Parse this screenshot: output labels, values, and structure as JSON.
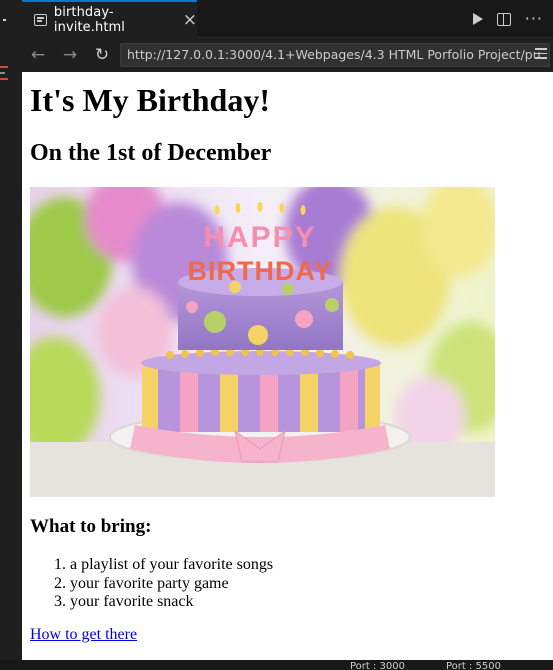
{
  "tab": {
    "title": "birthday-invite.html",
    "close": "×"
  },
  "nav": {
    "back": "←",
    "forward": "→",
    "reload": "↻",
    "url": "http://127.0.0.1:3000/4.1+Webpages/4.3 HTML Porfolio Project/pu"
  },
  "page": {
    "heading": "It's My Birthday!",
    "subheading": "On the 1st of December",
    "image_candle_letters": "HAPPY BIRTHDAY",
    "bring_heading": "What to bring:",
    "bring_items": [
      "a playlist of your favorite songs",
      "your favorite party game",
      "your favorite snack"
    ],
    "link_text": "How to get there"
  },
  "status": {
    "port_left": "Port : 3000",
    "port_right": "Port : 5500"
  },
  "colors": {
    "accent": "#0078d4",
    "link": "#0000ee"
  }
}
